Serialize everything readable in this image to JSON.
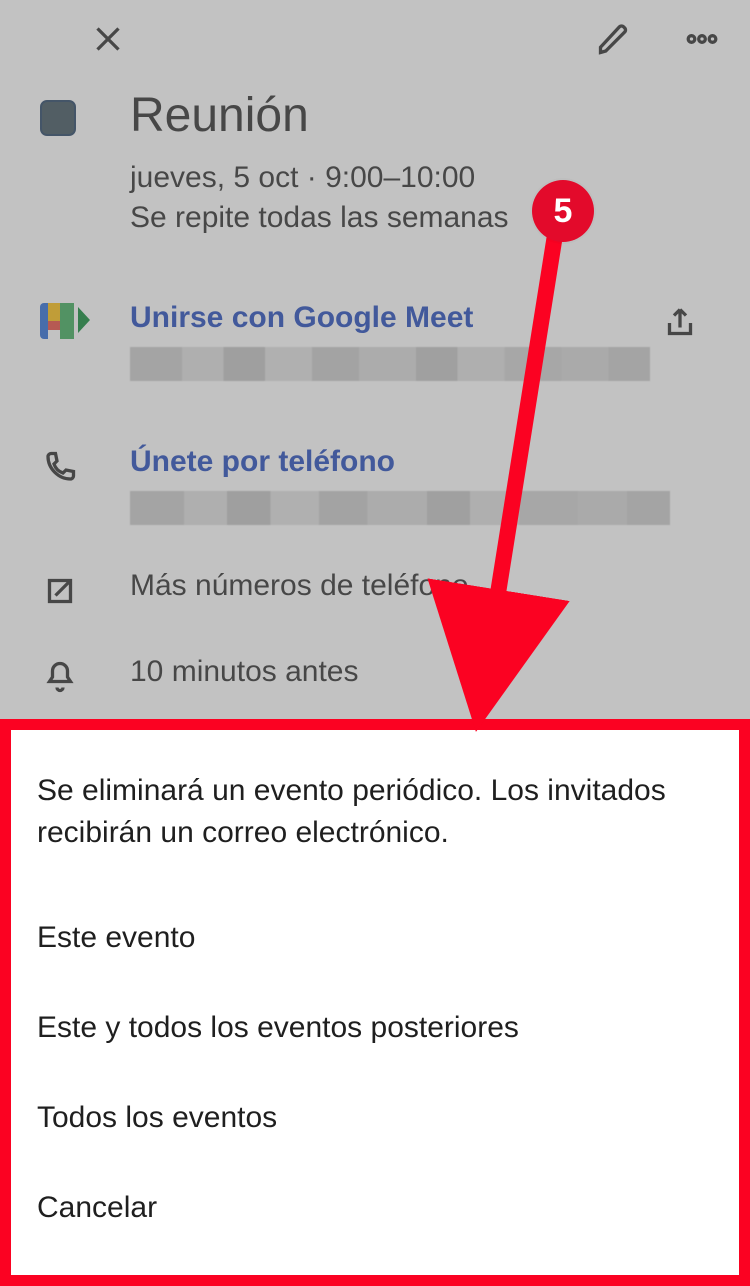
{
  "event": {
    "title": "Reunión",
    "date_line": "jueves, 5 oct · 9:00–10:00",
    "repeat_line": "Se repite todas las semanas"
  },
  "meet": {
    "link_label": "Unirse con Google Meet"
  },
  "phone": {
    "link_label": "Únete por teléfono"
  },
  "more_numbers": {
    "label": "Más números de teléfono"
  },
  "reminder": {
    "label": "10 minutos antes"
  },
  "sheet": {
    "title": "Se eliminará un evento periódico. Los invitados recibirán un correo electrónico.",
    "options": {
      "this": "Este evento",
      "following": "Este y todos los eventos posteriores",
      "all": "Todos los eventos",
      "cancel": "Cancelar"
    }
  },
  "annotation": {
    "badge": "5"
  },
  "colors": {
    "accent_red": "#fb0222",
    "link_blue": "#1641b9"
  }
}
